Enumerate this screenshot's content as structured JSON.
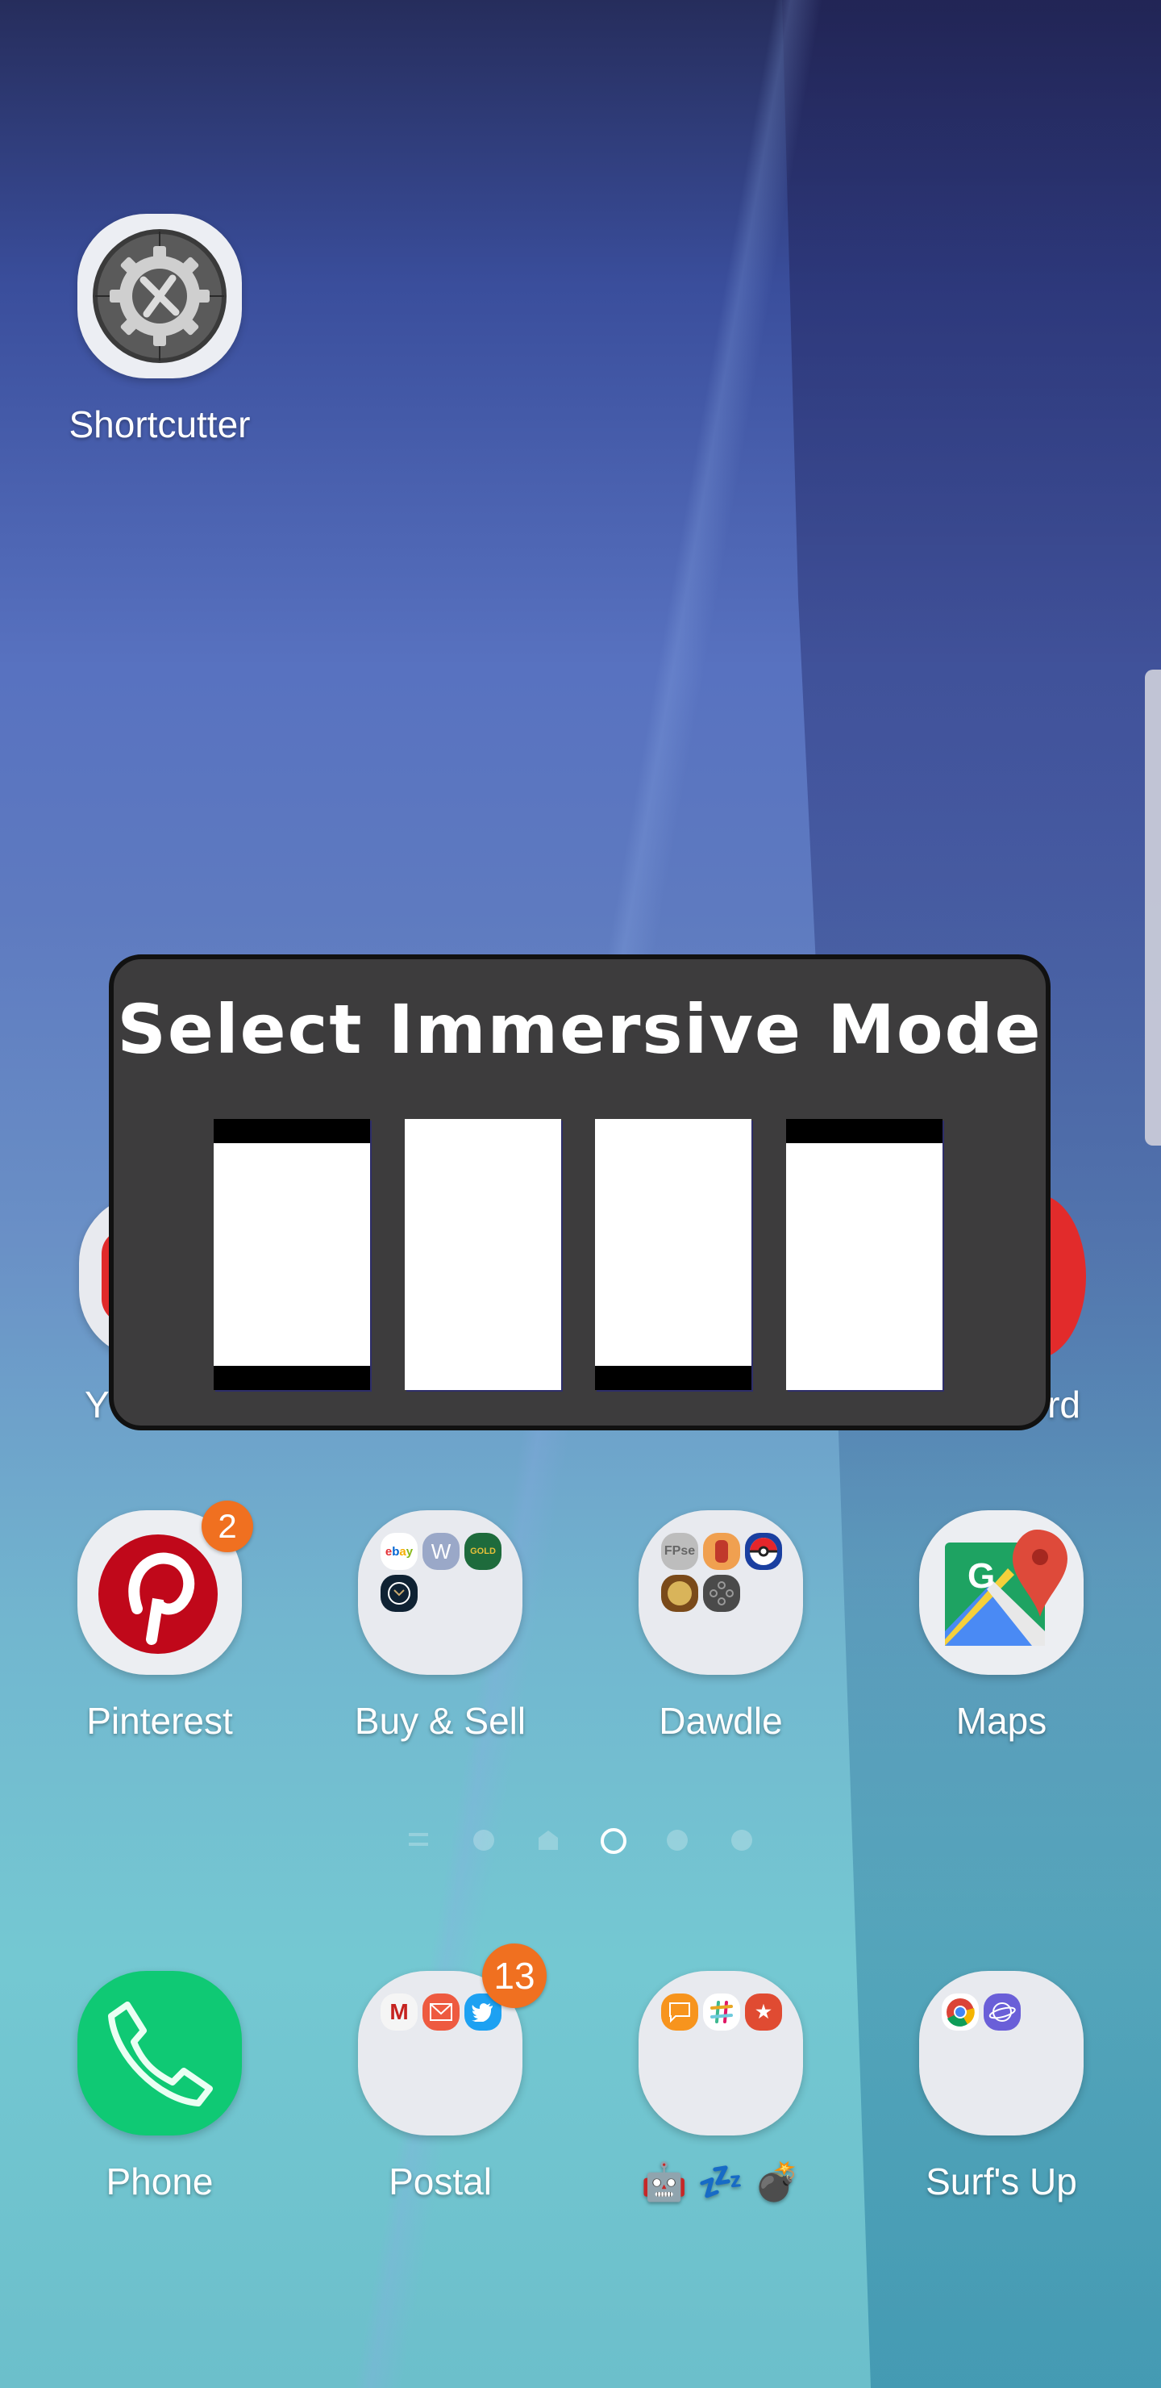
{
  "wallpaper": {
    "colors": [
      "#262d5c",
      "#5872c0",
      "#74c8d2"
    ]
  },
  "home": {
    "top_apps": [
      {
        "label": "Shortcutter",
        "icon": "gear-wrench-icon"
      }
    ],
    "hidden_row": [
      {
        "label": "Y",
        "icon": "youtube-icon"
      },
      {
        "label": "rd",
        "icon": "red-circle-app-icon"
      }
    ],
    "row3": [
      {
        "label": "Pinterest",
        "icon": "pinterest-icon",
        "badge": "2"
      },
      {
        "label": "Buy & Sell",
        "type": "folder",
        "contents": [
          "ebay",
          "W",
          "gold",
          "clock"
        ]
      },
      {
        "label": "Dawdle",
        "type": "folder",
        "contents": [
          "FPse",
          "hero",
          "pokeball",
          "warrior",
          "gamepad"
        ]
      },
      {
        "label": "Maps",
        "icon": "google-maps-icon"
      }
    ],
    "page_indicators": {
      "items": [
        "list",
        "dot",
        "home",
        "dot",
        "dot",
        "dot"
      ],
      "current_index": 3
    },
    "dock": [
      {
        "label": "Phone",
        "icon": "phone-icon"
      },
      {
        "label": "Postal",
        "type": "folder",
        "contents": [
          "gmail",
          "email",
          "twitter"
        ],
        "badge": "13"
      },
      {
        "label": "🤖 💤 💣",
        "type": "folder",
        "contents": [
          "messages",
          "slack",
          "wunderlist"
        ]
      },
      {
        "label": "Surf's Up",
        "type": "folder",
        "contents": [
          "chrome",
          "internet"
        ]
      }
    ]
  },
  "dialog": {
    "title": "Select Immersive Mode",
    "options": [
      {
        "name": "hide-both",
        "top_bar": true,
        "bottom_bar": true
      },
      {
        "name": "full-immersive",
        "top_bar": false,
        "bottom_bar": false
      },
      {
        "name": "hide-status",
        "top_bar": false,
        "bottom_bar": true
      },
      {
        "name": "hide-navigation",
        "top_bar": true,
        "bottom_bar": false
      }
    ]
  },
  "mini_labels": {
    "ebay": "ebay",
    "w": "W",
    "gold": "GOLD",
    "fpse": "FPse",
    "gmail": "M"
  }
}
